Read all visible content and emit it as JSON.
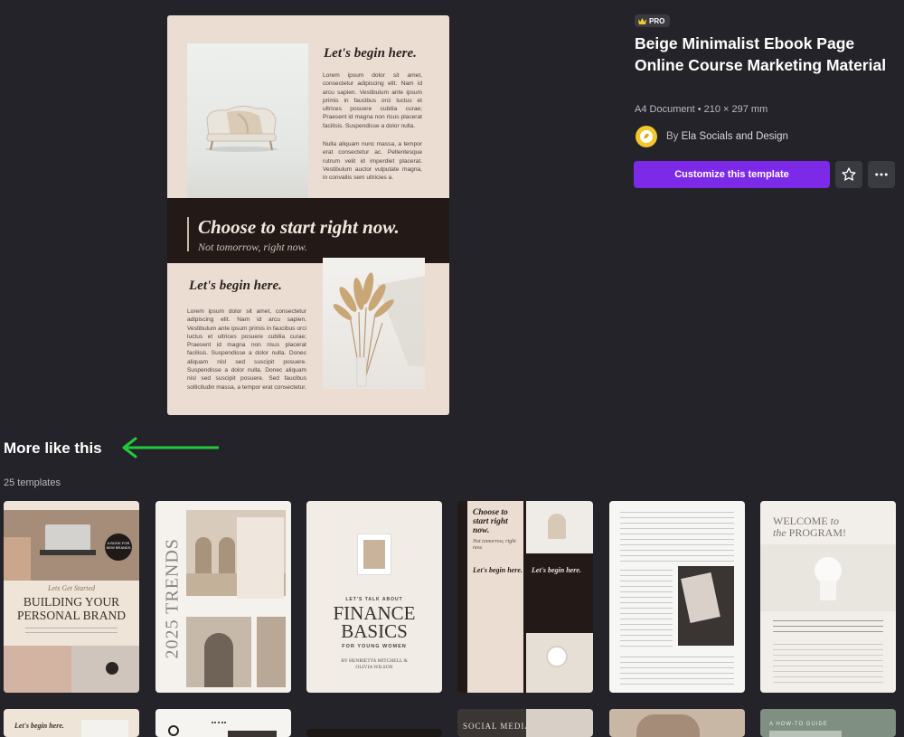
{
  "preview": {
    "heading1": "Let's begin here.",
    "para1": "Lorem ipsum dolor sit amet, consectetur adipiscing elit. Nam id arcu sapien. Vestibulum ante ipsum primis in faucibus orci luctus et ultrices posuere cubilia curae; Praesent id magna non risus placerat facilisis. Suspendisse a dolor nulla.",
    "para2": "Nulla aliquam nunc massa, a tempor erat consectetur ac. Pellentesque rutrum velit id imperdiet placerat. Vestibulum auctor vulputate magna, in convallis sem ultricies a.",
    "band_title": "Choose to start right now.",
    "band_subtitle": "Not tomorrow, right now.",
    "heading2": "Let's begin here.",
    "para3": "Lorem ipsum dolor sit amet, consectetur adipiscing elit. Nam id arcu sapien. Vestibulum ante ipsum primis in faucibus orci luctus et ultrices posuere cubilia curae; Praesent id magna non risus placerat facilisis. Suspendisse a dolor nulla. Donec aliquam nisl sed suscipit posuere. Suspendisse a dolor nulla. Donec aliquam nisl sed suscipit posuere. Sed faucibus sollicitudin massa, a tempor erat consectetur."
  },
  "template": {
    "badge": "PRO",
    "title": "Beige Minimalist Ebook Page Online Course Marketing Material",
    "meta": "A4 Document • 210 × 297 mm",
    "author_prefix": "By",
    "author": "Ela Socials and Design",
    "customize_label": "Customize this template",
    "favorite_icon": "star-icon",
    "more_icon": "ellipsis-icon"
  },
  "more_like_this": {
    "title": "More like this",
    "count": "25 templates",
    "arrow_color": "#22c93a"
  },
  "cards": {
    "c1": {
      "small": "Lets Get Started",
      "title": "BUILDING YOUR PERSONAL BRAND",
      "badge": "A BOOK FOR NEW BRANDS"
    },
    "c2": {
      "vertical": "2025 TRENDS"
    },
    "c3": {
      "kicker": "LET'S TALK ABOUT",
      "title_line1": "FINANCE",
      "title_line2": "BASICS",
      "sub": "FOR YOUNG WOMEN",
      "authors": "BY HENRIETTA MITCHELL & OLIVIA WILSON"
    },
    "c4": {
      "title": "Choose to start right now.",
      "sub": "Not tomorrow, right now.",
      "h1": "Let's begin here.",
      "h2": "Let's begin here."
    },
    "c6": {
      "title_a": "WELCOME",
      "title_b": "to",
      "title_c": "the",
      "title_d": "PROGRAM!"
    },
    "r2c1": {
      "text": "Let's begin here."
    },
    "r2c4": {
      "text": "SOCIAL MEDIA"
    },
    "r2c6": {
      "text": "A HOW-TO GUIDE"
    }
  },
  "colors": {
    "background": "#232329",
    "accent": "#7d2ae8",
    "pro_badge": "#f3c62b",
    "preview_beige": "#ecddd3",
    "preview_dark": "#231a18"
  }
}
